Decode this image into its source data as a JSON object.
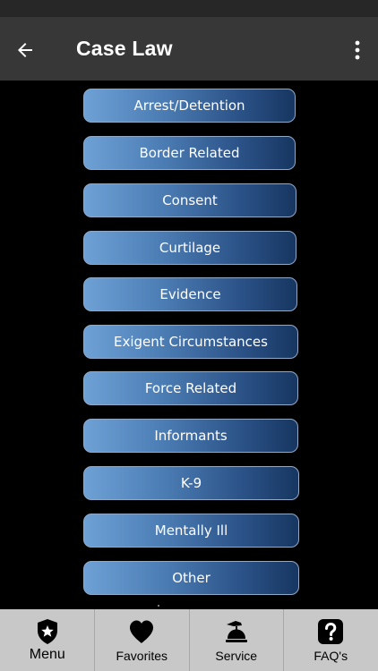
{
  "header": {
    "title": "Case Law"
  },
  "categories": [
    {
      "label": "Arrest/Detention"
    },
    {
      "label": "Border Related"
    },
    {
      "label": "Consent"
    },
    {
      "label": "Curtilage"
    },
    {
      "label": "Evidence"
    },
    {
      "label": "Exigent Circumstances"
    },
    {
      "label": "Force Related"
    },
    {
      "label": "Informants"
    },
    {
      "label": "K-9"
    },
    {
      "label": "Mentally Ill"
    },
    {
      "label": "Other"
    }
  ],
  "bottom_nav": {
    "items": [
      {
        "label": "Menu",
        "icon": "shield-star-icon"
      },
      {
        "label": "Favorites",
        "icon": "heart-icon"
      },
      {
        "label": "Service",
        "icon": "service-bell-icon"
      },
      {
        "label": "FAQ's",
        "icon": "question-icon"
      }
    ]
  },
  "colors": {
    "status_bar": "#272727",
    "app_bar": "#373737",
    "background": "#000000",
    "button_gradient_start": "#6ea1d6",
    "button_gradient_end": "#173661",
    "bottom_nav": "#c8c8c8"
  }
}
